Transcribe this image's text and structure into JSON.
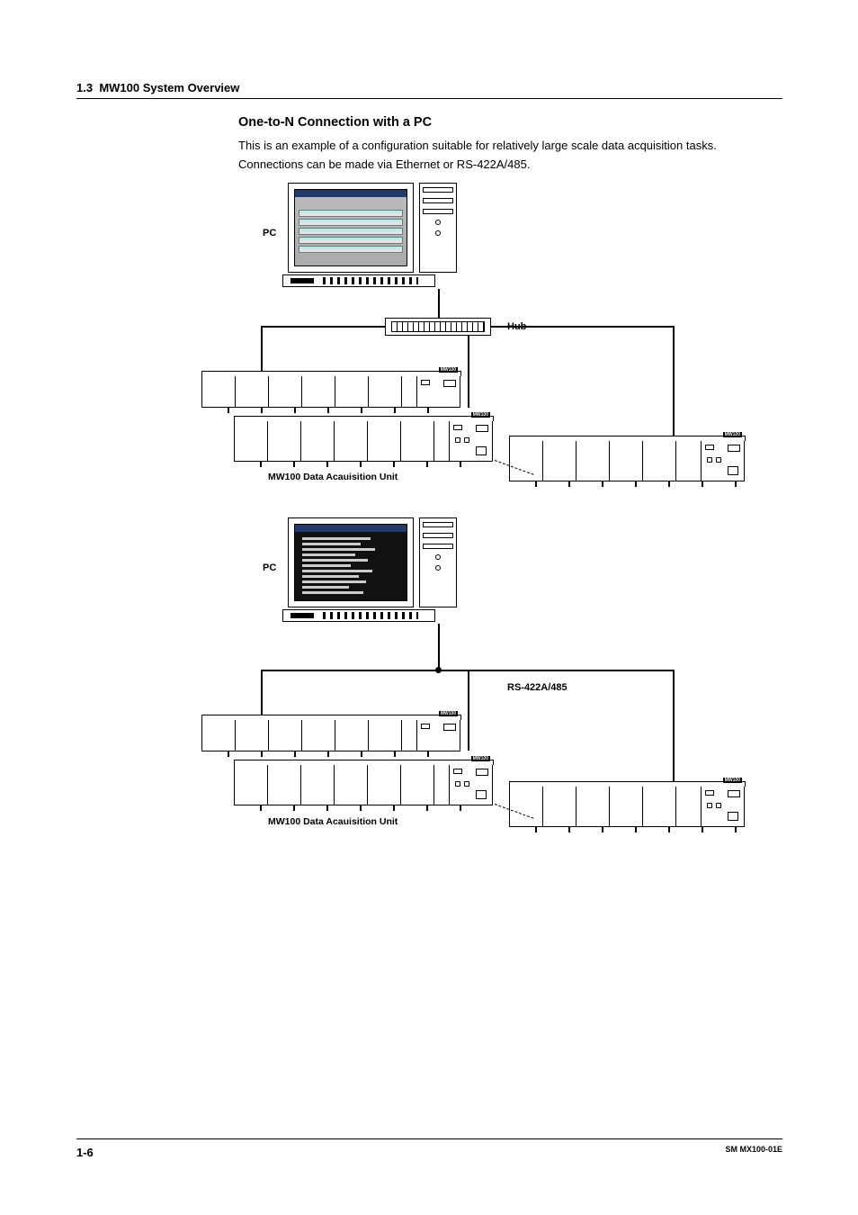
{
  "header": {
    "section_number": "1.3",
    "section_title": "MW100 System Overview"
  },
  "content": {
    "heading": "One-to-N Connection with a PC",
    "body": "This is an example of a configuration suitable for relatively large scale data acquisition tasks.  Connections can be made via Ethernet or RS-422A/485."
  },
  "diagram": {
    "pc_label": "PC",
    "hub_label": "Hub",
    "unit_label": "MW100 Data Acauisition Unit",
    "serial_label": "RS-422A/485",
    "unit_tag": "MW100"
  },
  "footer": {
    "page": "1-6",
    "doc_id": "SM MX100-01E"
  }
}
